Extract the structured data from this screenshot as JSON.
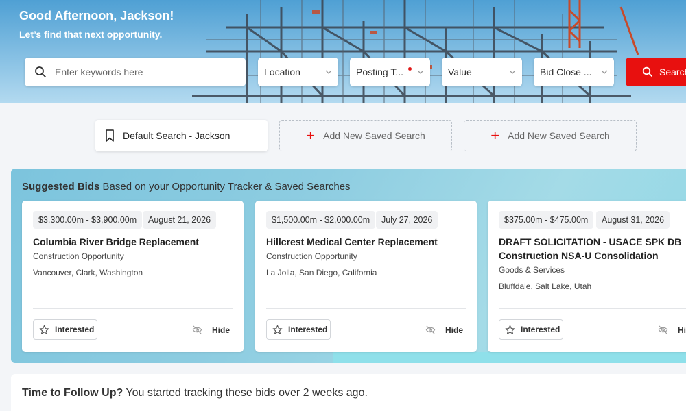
{
  "hero": {
    "greeting": "Good Afternoon, Jackson!",
    "subtitle": "Let’s find that next opportunity."
  },
  "search": {
    "placeholder": "Enter keywords here",
    "filters": [
      "Location",
      "Posting T...",
      "Value",
      "Bid Close ..."
    ],
    "button_label": "Search"
  },
  "saved_searches": {
    "default_label": "Default Search - Jackson",
    "add_label_1": "Add New Saved Search",
    "add_label_2": "Add New Saved Search"
  },
  "suggested": {
    "title_bold": "Suggested Bids",
    "title_rest": " Based on your Opportunity Tracker & Saved Searches",
    "cards": [
      {
        "value": "$3,300.00m - $3,900.00m",
        "date": "August 21, 2026",
        "title": "Columbia River Bridge Replacement",
        "type": "Construction Opportunity",
        "location": "Vancouver, Clark, Washington"
      },
      {
        "value": "$1,500.00m - $2,000.00m",
        "date": "July 27, 2026",
        "title": "Hillcrest Medical Center Replacement",
        "type": "Construction Opportunity",
        "location": "La Jolla, San Diego, California"
      },
      {
        "value": "$375.00m - $475.00m",
        "date": "August 31, 2026",
        "title": "DRAFT SOLICITATION - USACE SPK DB Construction NSA-U Consolidation Mission...",
        "type": "Goods & Services",
        "location": "Bluffdale, Salt Lake, Utah"
      }
    ],
    "interested_label": "Interested",
    "hide_label": "Hide"
  },
  "followup": {
    "title_bold": "Time to Follow Up?",
    "title_rest": " You started tracking these bids over 2 weeks ago."
  },
  "colors": {
    "accent": "#e8100f",
    "hero_sky": "#6fb8e0",
    "panel": "#8ecde1"
  }
}
